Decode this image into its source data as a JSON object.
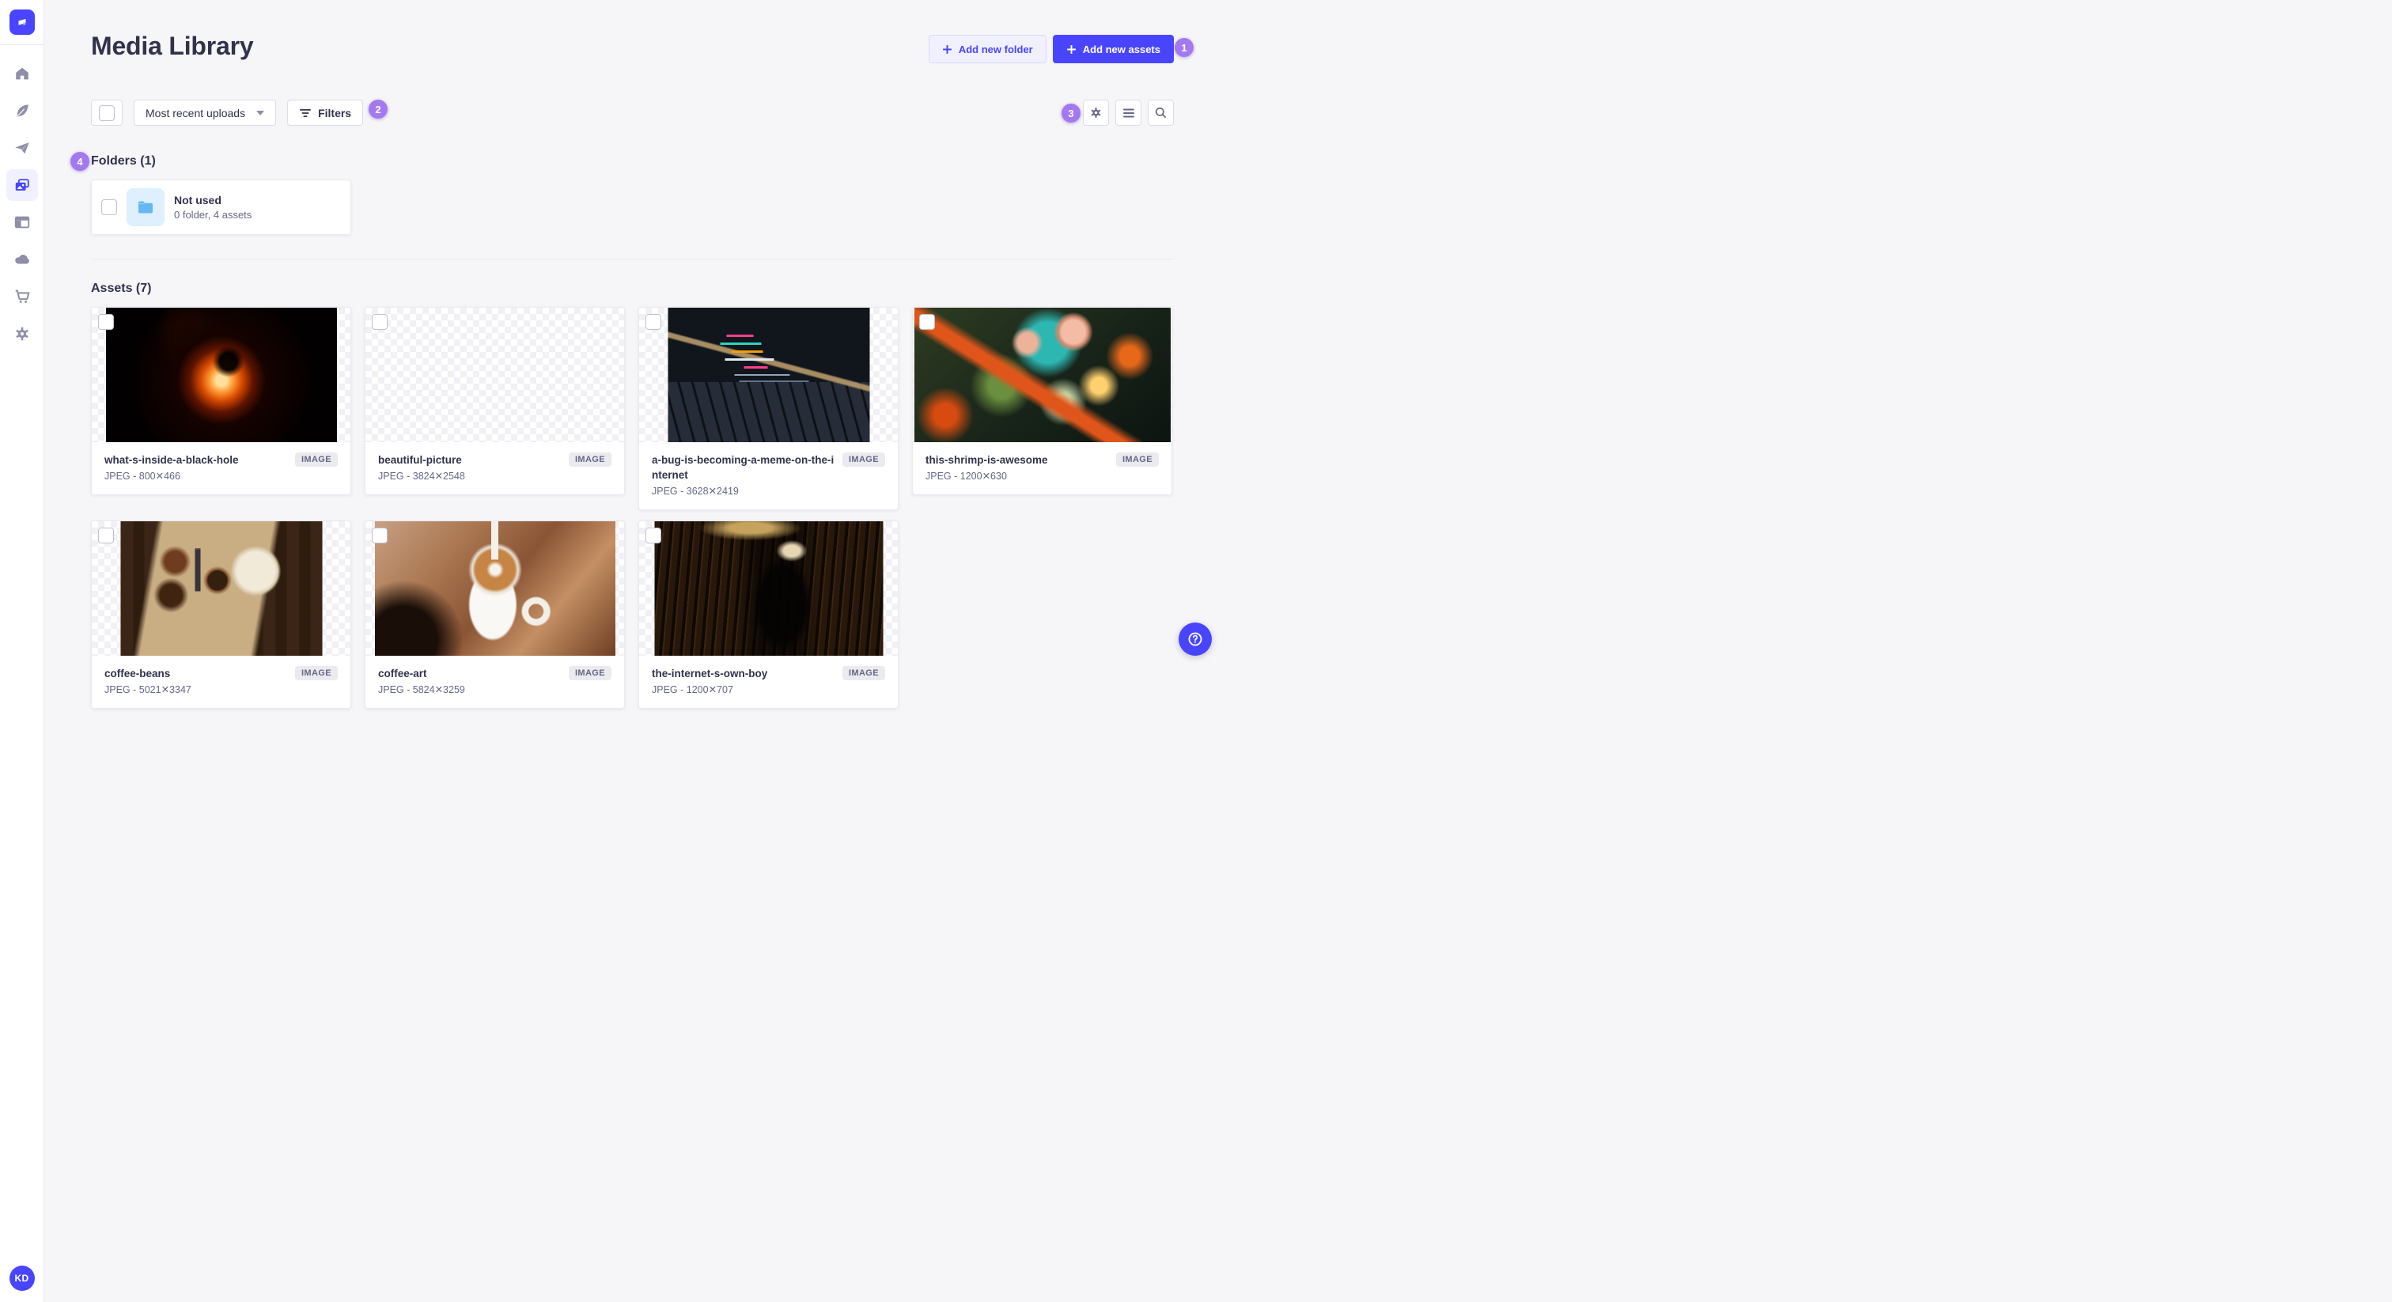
{
  "app": {
    "name": "Strapi admin"
  },
  "colors": {
    "primary": "#4945ff",
    "annotation_purple": "#a479f0",
    "folder_blue": "#66b7f1",
    "text_dark": "#32324d",
    "text_muted": "#666687",
    "background": "#f6f6f9"
  },
  "sidebar": {
    "items": [
      {
        "icon": "home-icon",
        "active": false
      },
      {
        "icon": "feather-icon",
        "active": false
      },
      {
        "icon": "paper-plane-icon",
        "active": false
      },
      {
        "icon": "media-library-icon",
        "active": true
      },
      {
        "icon": "layout-icon",
        "active": false
      },
      {
        "icon": "cloud-icon",
        "active": false
      },
      {
        "icon": "cart-icon",
        "active": false
      },
      {
        "icon": "gear-icon",
        "active": false
      }
    ],
    "avatar_initials": "KD"
  },
  "header": {
    "title": "Media Library",
    "add_folder_label": "Add new folder",
    "add_assets_label": "Add new assets"
  },
  "toolbar": {
    "sort_value": "Most recent uploads",
    "filters_label": "Filters",
    "view_controls": [
      "settings-icon",
      "list-icon",
      "search-icon"
    ]
  },
  "folders": {
    "title": "Folders (1)",
    "items": [
      {
        "name": "Not used",
        "meta": "0 folder, 4 assets"
      }
    ]
  },
  "assets": {
    "title": "Assets (7)",
    "badge_label": "IMAGE",
    "items": [
      {
        "name": "what-s-inside-a-black-hole",
        "meta": "JPEG - 800✕466"
      },
      {
        "name": "beautiful-picture",
        "meta": "JPEG - 3824✕2548"
      },
      {
        "name": "a-bug-is-becoming-a-meme-on-the-internet",
        "meta": "JPEG - 3628✕2419"
      },
      {
        "name": "this-shrimp-is-awesome",
        "meta": "JPEG - 1200✕630"
      },
      {
        "name": "coffee-beans",
        "meta": "JPEG - 5021✕3347"
      },
      {
        "name": "coffee-art",
        "meta": "JPEG - 5824✕3259"
      },
      {
        "name": "the-internet-s-own-boy",
        "meta": "JPEG - 1200✕707"
      }
    ]
  },
  "annotations": {
    "a1": "1",
    "a2": "2",
    "a3": "3",
    "a4": "4"
  }
}
